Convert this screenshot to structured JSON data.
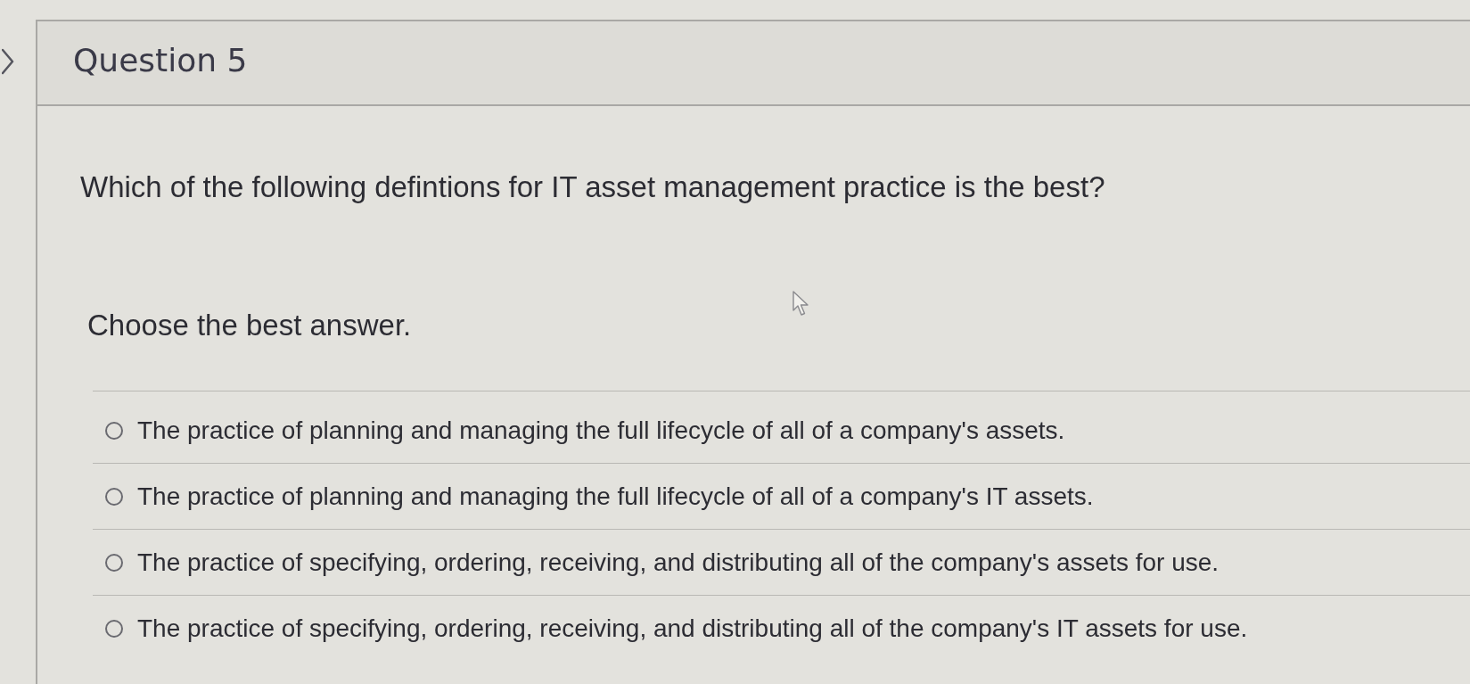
{
  "header": {
    "title": "Question 5"
  },
  "question": {
    "prompt": "Which of the following defintions for IT asset management practice is the best?",
    "instruction": "Choose the best answer."
  },
  "options": [
    {
      "label": "The practice of planning and managing the full lifecycle of all of a company's assets.",
      "selected": false
    },
    {
      "label": "The practice of planning and managing the full lifecycle of all of a company's IT assets.",
      "selected": false
    },
    {
      "label": "The practice of specifying, ordering, receiving, and distributing all of the company's assets for use.",
      "selected": false
    },
    {
      "label": "The practice of specifying, ordering, receiving, and distributing all of the company's IT assets for use.",
      "selected": false
    }
  ]
}
